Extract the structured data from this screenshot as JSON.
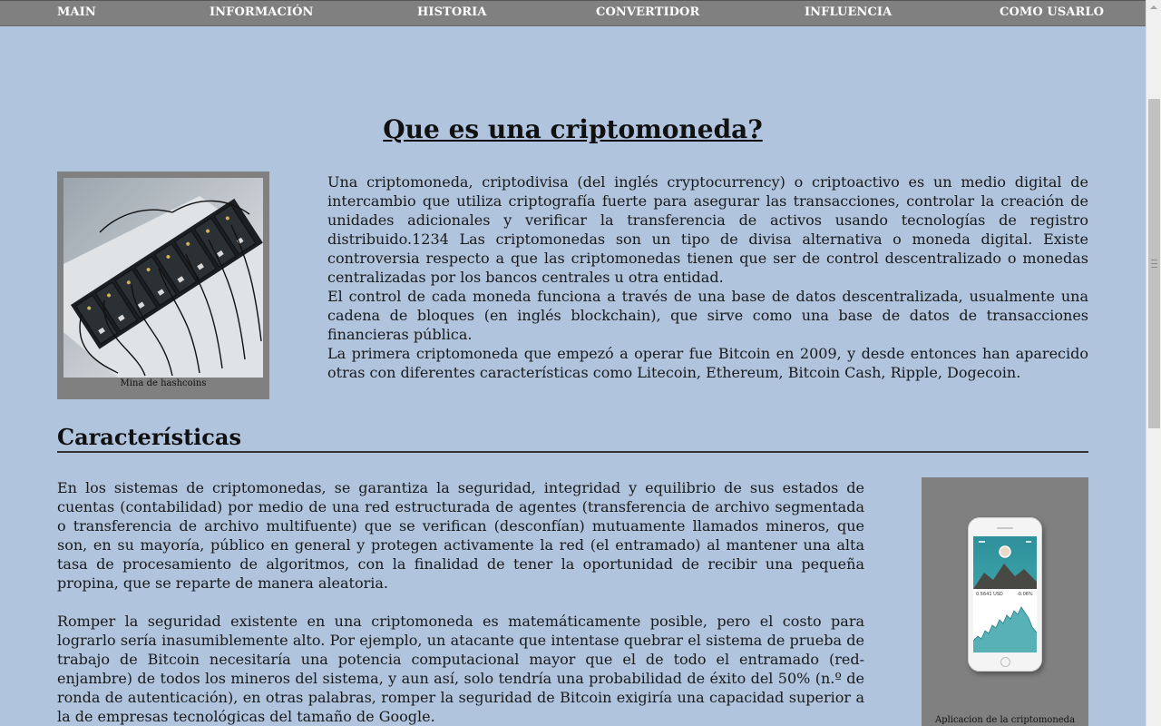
{
  "nav": {
    "items": [
      "MAIN",
      "INFORMACIÓN",
      "HISTORIA",
      "CONVERTIDOR",
      "INFLUENCIA",
      "COMO USARLO"
    ]
  },
  "main": {
    "title": "Que es una criptomoneda?",
    "figure1_caption": "Mina de hashcoins",
    "intro_paragraphs": [
      "Una criptomoneda, criptodivisa (del inglés cryptocurrency) o criptoactivo es un medio digital de intercambio que utiliza criptografía fuerte para asegurar las transacciones, controlar la creación de unidades adicionales y verificar la transferencia de activos usando tecnologías de registro distribuido.1234 Las criptomonedas son un tipo de divisa alternativa o moneda digital. Existe controversia respecto a que las criptomonedas tienen que ser de control descentralizado o monedas centralizadas por los bancos centrales u otra entidad.",
      "El control de cada moneda funciona a través de una base de datos descentralizada, usualmente una cadena de bloques (en inglés blockchain), que sirve como una base de datos de transacciones financieras pública.",
      "La primera criptomoneda que empezó a operar fue Bitcoin en 2009, y desde entonces han aparecido otras con diferentes características como Litecoin, Ethereum, Bitcoin Cash, Ripple, Dogecoin."
    ],
    "section_heading": "Características",
    "section_paragraphs": [
      "En los sistemas de criptomonedas, se garantiza la seguridad, integridad y equilibrio de sus estados de cuentas (contabilidad) por medio de una red estructurada de agentes (transferencia de archivo segmentada o transferencia de archivo multifuente) que se verifican (desconfían) mutuamente llamados mineros, que son, en su mayoría, público en general y protegen activamente la red (el entramado) al mantener una alta tasa de procesamiento de algoritmos, con la finalidad de tener la oportunidad de recibir una pequeña propina, que se reparte de manera aleatoria.",
      "Romper la seguridad existente en una criptomoneda es matemáticamente posible, pero el costo para lograrlo sería inasumiblemente alto. Por ejemplo, un atacante que intentase quebrar el sistema de prueba de trabajo de Bitcoin necesitaría una potencia computacional mayor que el de todo el entramado (red-enjambre) de todos los mineros del sistema, y aun así, solo tendría una probabilidad de éxito del 50% (n.º de ronda de autenticación), en otras palabras, romper la seguridad de Bitcoin exigiría una capacidad superior a la de empresas tecnológicas del tamaño de Google."
    ],
    "figure2_caption": "Aplicacion de la criptomoneda",
    "phone_screen": {
      "balance": "0.5641 USD",
      "change": "-0.06%"
    }
  },
  "colors": {
    "page_background": "#b0c4de",
    "navbar_background": "#808080",
    "figure_frame": "#808080",
    "chart_teal": "#3aa3a8"
  }
}
